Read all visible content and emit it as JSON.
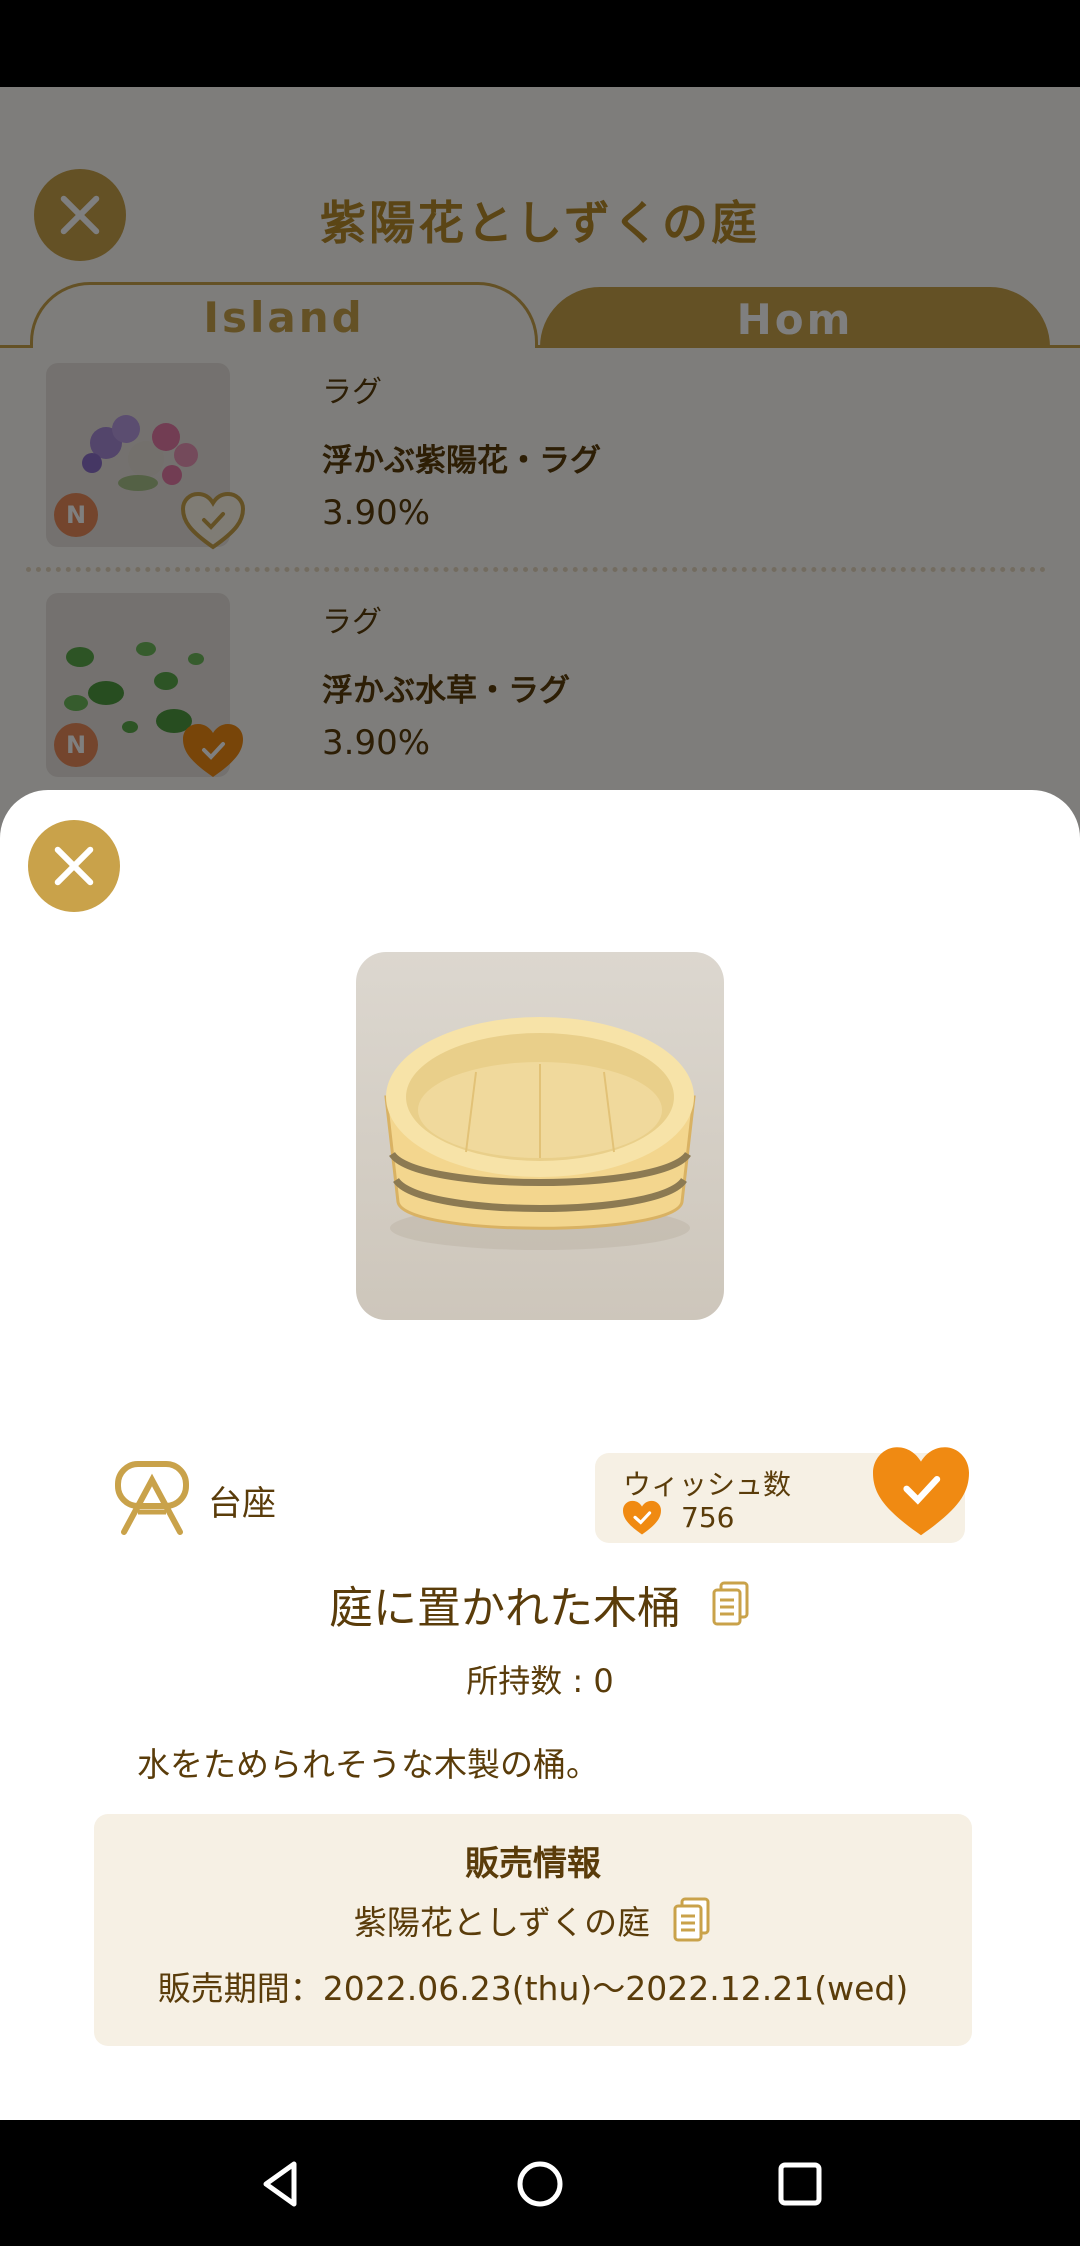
{
  "background": {
    "title": "紫陽花としずくの庭",
    "tabs": [
      {
        "label": "Island"
      },
      {
        "label": "Hom"
      }
    ],
    "items": [
      {
        "category": "ラグ",
        "name": "浮かぶ紫陽花・ラグ",
        "percent": "3.90%",
        "badge": "N",
        "wished": false
      },
      {
        "category": "ラグ",
        "name": "浮かぶ水草・ラグ",
        "percent": "3.90%",
        "badge": "N",
        "wished": true
      }
    ]
  },
  "detail": {
    "category_label": "台座",
    "wish": {
      "label": "ウィッシュ数",
      "count": "756",
      "wished": true
    },
    "title": "庭に置かれた木桶",
    "owned": "所持数 : 0",
    "description": "水をためられそうな木製の桶。",
    "sale": {
      "heading": "販売情報",
      "shop": "紫陽花としずくの庭",
      "period": "販売期間：2022.06.23(thu)〜2022.12.21(wed)"
    }
  },
  "colors": {
    "accent": "#c9a24a",
    "heart": "#f08a12",
    "text": "#5a3c0a",
    "panel": "#f6f0e4"
  }
}
